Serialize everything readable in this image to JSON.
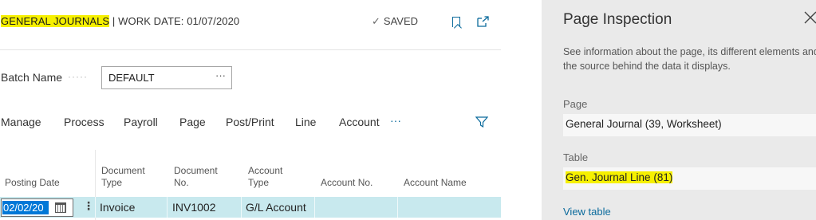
{
  "header": {
    "title_highlight": "GENERAL JOURNALS",
    "title_rest": " | WORK DATE: 01/07/2020",
    "status": "SAVED"
  },
  "batch": {
    "label": "Batch Name",
    "dots": "·····",
    "value": "DEFAULT",
    "lookup": "···"
  },
  "menu": {
    "items": [
      "Manage",
      "Process",
      "Payroll",
      "Page",
      "Post/Print",
      "Line",
      "Account"
    ],
    "more": "···"
  },
  "table": {
    "columns": [
      {
        "line1": "",
        "line2": "Posting Date"
      },
      {
        "line1": "Document",
        "line2": "Type"
      },
      {
        "line1": "Document",
        "line2": "No."
      },
      {
        "line1": "Account",
        "line2": "Type"
      },
      {
        "line1": "",
        "line2": "Account No."
      },
      {
        "line1": "",
        "line2": "Account Name"
      }
    ],
    "row": {
      "posting_date": "02/02/20",
      "document_type": "Invoice",
      "document_no": "INV1002",
      "account_type": "G/L Account",
      "account_no": "",
      "account_name": ""
    },
    "row_menu": "⋮"
  },
  "panel": {
    "title": "Page Inspection",
    "description": "See information about the page, its different elements and the source behind the data it displays.",
    "page_label": "Page",
    "page_value": "General Journal (39, Worksheet)",
    "table_label": "Table",
    "table_value": "Gen. Journal Line (81)",
    "link": "View table"
  },
  "icons": {
    "saved": "check-icon",
    "bookmark": "bookmark-icon",
    "popout": "open-in-new-window-icon",
    "filter": "filter-icon",
    "calendar": "calendar-icon",
    "close": "close-icon"
  },
  "colors": {
    "highlight": "#f6f000",
    "accent": "#0a6a9c",
    "row_selected": "#c8e9ee",
    "selection": "#0078d7",
    "panel_bg": "#eaeaea"
  }
}
